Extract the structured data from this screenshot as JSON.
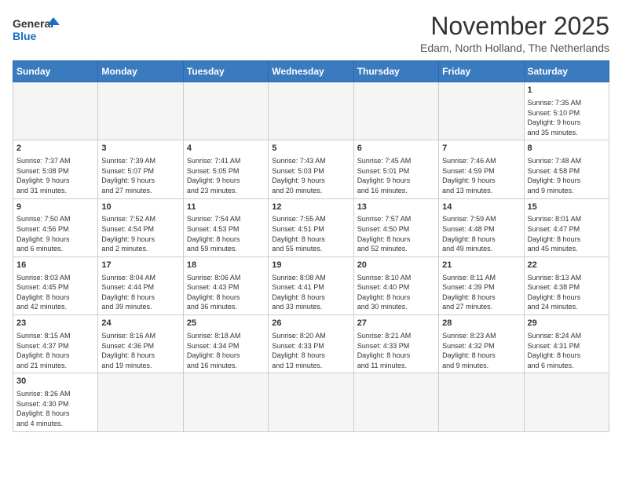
{
  "header": {
    "logo_general": "General",
    "logo_blue": "Blue",
    "month_title": "November 2025",
    "location": "Edam, North Holland, The Netherlands"
  },
  "weekdays": [
    "Sunday",
    "Monday",
    "Tuesday",
    "Wednesday",
    "Thursday",
    "Friday",
    "Saturday"
  ],
  "weeks": [
    [
      {
        "day": "",
        "info": ""
      },
      {
        "day": "",
        "info": ""
      },
      {
        "day": "",
        "info": ""
      },
      {
        "day": "",
        "info": ""
      },
      {
        "day": "",
        "info": ""
      },
      {
        "day": "",
        "info": ""
      },
      {
        "day": "1",
        "info": "Sunrise: 7:35 AM\nSunset: 5:10 PM\nDaylight: 9 hours\nand 35 minutes."
      }
    ],
    [
      {
        "day": "2",
        "info": "Sunrise: 7:37 AM\nSunset: 5:08 PM\nDaylight: 9 hours\nand 31 minutes."
      },
      {
        "day": "3",
        "info": "Sunrise: 7:39 AM\nSunset: 5:07 PM\nDaylight: 9 hours\nand 27 minutes."
      },
      {
        "day": "4",
        "info": "Sunrise: 7:41 AM\nSunset: 5:05 PM\nDaylight: 9 hours\nand 23 minutes."
      },
      {
        "day": "5",
        "info": "Sunrise: 7:43 AM\nSunset: 5:03 PM\nDaylight: 9 hours\nand 20 minutes."
      },
      {
        "day": "6",
        "info": "Sunrise: 7:45 AM\nSunset: 5:01 PM\nDaylight: 9 hours\nand 16 minutes."
      },
      {
        "day": "7",
        "info": "Sunrise: 7:46 AM\nSunset: 4:59 PM\nDaylight: 9 hours\nand 13 minutes."
      },
      {
        "day": "8",
        "info": "Sunrise: 7:48 AM\nSunset: 4:58 PM\nDaylight: 9 hours\nand 9 minutes."
      }
    ],
    [
      {
        "day": "9",
        "info": "Sunrise: 7:50 AM\nSunset: 4:56 PM\nDaylight: 9 hours\nand 6 minutes."
      },
      {
        "day": "10",
        "info": "Sunrise: 7:52 AM\nSunset: 4:54 PM\nDaylight: 9 hours\nand 2 minutes."
      },
      {
        "day": "11",
        "info": "Sunrise: 7:54 AM\nSunset: 4:53 PM\nDaylight: 8 hours\nand 59 minutes."
      },
      {
        "day": "12",
        "info": "Sunrise: 7:55 AM\nSunset: 4:51 PM\nDaylight: 8 hours\nand 55 minutes."
      },
      {
        "day": "13",
        "info": "Sunrise: 7:57 AM\nSunset: 4:50 PM\nDaylight: 8 hours\nand 52 minutes."
      },
      {
        "day": "14",
        "info": "Sunrise: 7:59 AM\nSunset: 4:48 PM\nDaylight: 8 hours\nand 49 minutes."
      },
      {
        "day": "15",
        "info": "Sunrise: 8:01 AM\nSunset: 4:47 PM\nDaylight: 8 hours\nand 45 minutes."
      }
    ],
    [
      {
        "day": "16",
        "info": "Sunrise: 8:03 AM\nSunset: 4:45 PM\nDaylight: 8 hours\nand 42 minutes."
      },
      {
        "day": "17",
        "info": "Sunrise: 8:04 AM\nSunset: 4:44 PM\nDaylight: 8 hours\nand 39 minutes."
      },
      {
        "day": "18",
        "info": "Sunrise: 8:06 AM\nSunset: 4:43 PM\nDaylight: 8 hours\nand 36 minutes."
      },
      {
        "day": "19",
        "info": "Sunrise: 8:08 AM\nSunset: 4:41 PM\nDaylight: 8 hours\nand 33 minutes."
      },
      {
        "day": "20",
        "info": "Sunrise: 8:10 AM\nSunset: 4:40 PM\nDaylight: 8 hours\nand 30 minutes."
      },
      {
        "day": "21",
        "info": "Sunrise: 8:11 AM\nSunset: 4:39 PM\nDaylight: 8 hours\nand 27 minutes."
      },
      {
        "day": "22",
        "info": "Sunrise: 8:13 AM\nSunset: 4:38 PM\nDaylight: 8 hours\nand 24 minutes."
      }
    ],
    [
      {
        "day": "23",
        "info": "Sunrise: 8:15 AM\nSunset: 4:37 PM\nDaylight: 8 hours\nand 21 minutes."
      },
      {
        "day": "24",
        "info": "Sunrise: 8:16 AM\nSunset: 4:36 PM\nDaylight: 8 hours\nand 19 minutes."
      },
      {
        "day": "25",
        "info": "Sunrise: 8:18 AM\nSunset: 4:34 PM\nDaylight: 8 hours\nand 16 minutes."
      },
      {
        "day": "26",
        "info": "Sunrise: 8:20 AM\nSunset: 4:33 PM\nDaylight: 8 hours\nand 13 minutes."
      },
      {
        "day": "27",
        "info": "Sunrise: 8:21 AM\nSunset: 4:33 PM\nDaylight: 8 hours\nand 11 minutes."
      },
      {
        "day": "28",
        "info": "Sunrise: 8:23 AM\nSunset: 4:32 PM\nDaylight: 8 hours\nand 9 minutes."
      },
      {
        "day": "29",
        "info": "Sunrise: 8:24 AM\nSunset: 4:31 PM\nDaylight: 8 hours\nand 6 minutes."
      }
    ],
    [
      {
        "day": "30",
        "info": "Sunrise: 8:26 AM\nSunset: 4:30 PM\nDaylight: 8 hours\nand 4 minutes."
      },
      {
        "day": "",
        "info": ""
      },
      {
        "day": "",
        "info": ""
      },
      {
        "day": "",
        "info": ""
      },
      {
        "day": "",
        "info": ""
      },
      {
        "day": "",
        "info": ""
      },
      {
        "day": "",
        "info": ""
      }
    ]
  ]
}
